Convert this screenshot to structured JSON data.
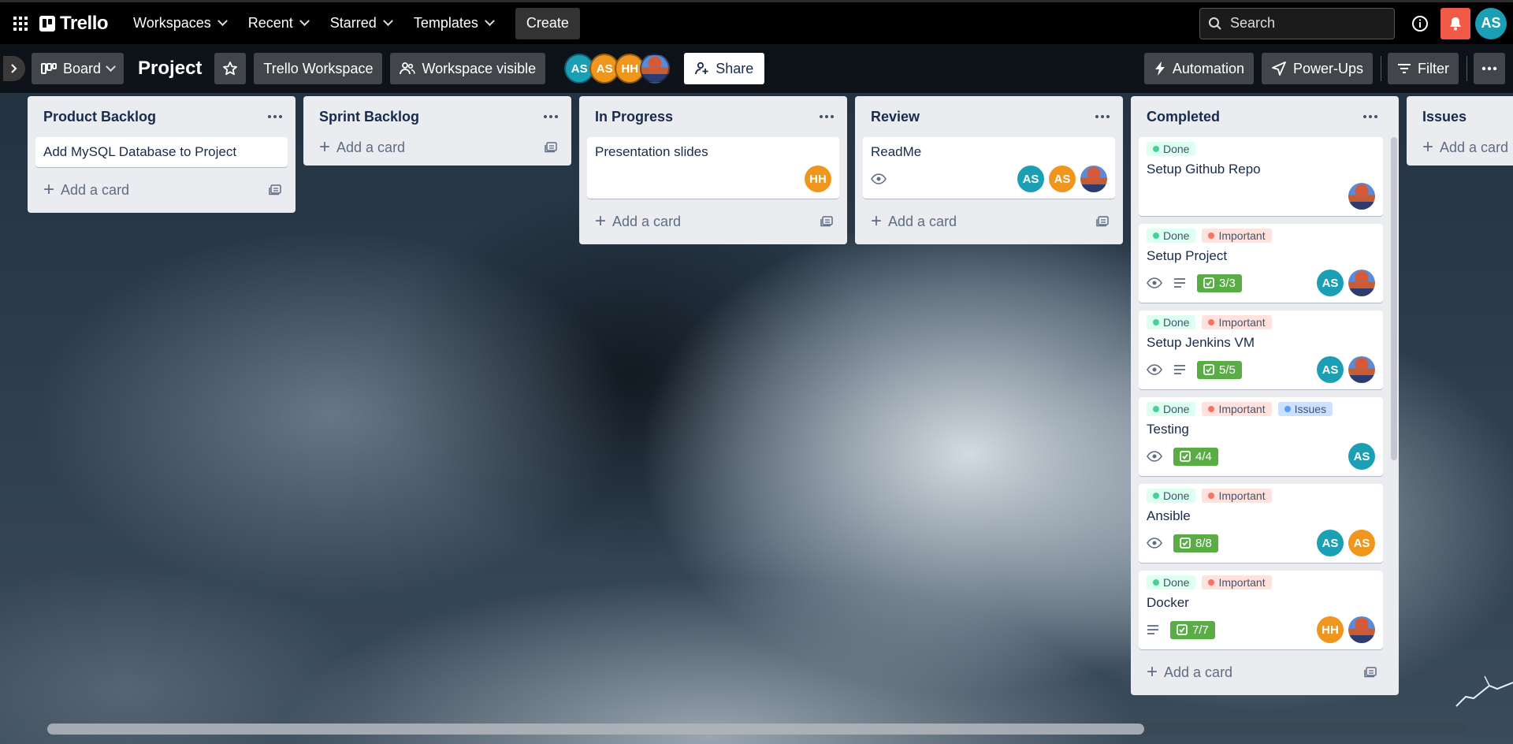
{
  "header": {
    "logo": "Trello",
    "nav": [
      "Workspaces",
      "Recent",
      "Starred",
      "Templates"
    ],
    "create_label": "Create",
    "search_placeholder": "Search",
    "user_initials": "AS"
  },
  "board": {
    "view_label": "Board",
    "title": "Project",
    "workspace_label": "Trello Workspace",
    "visibility_label": "Workspace visible",
    "members": [
      "AS",
      "AS",
      "HH"
    ],
    "share_label": "Share",
    "automation_label": "Automation",
    "powerups_label": "Power-Ups",
    "filter_label": "Filter"
  },
  "add_card_label": "Add a card",
  "lists": [
    {
      "title": "Product Backlog",
      "cards": [
        {
          "title": "Add MySQL Database to Project"
        }
      ]
    },
    {
      "title": "Sprint Backlog",
      "cards": []
    },
    {
      "title": "In Progress",
      "cards": [
        {
          "title": "Presentation slides",
          "members": [
            "HH"
          ]
        }
      ]
    },
    {
      "title": "Review",
      "cards": [
        {
          "title": "ReadMe",
          "members": [
            "AS",
            "AS",
            "photo"
          ]
        }
      ]
    },
    {
      "title": "Completed",
      "cards": [
        {
          "title": "Setup Github Repo",
          "labels": [
            "Done"
          ]
        },
        {
          "title": "Setup Project",
          "labels": [
            "Done",
            "Important"
          ],
          "checklist": "3/3"
        },
        {
          "title": "Setup Jenkins VM",
          "labels": [
            "Done",
            "Important"
          ],
          "checklist": "5/5"
        },
        {
          "title": "Testing",
          "labels": [
            "Done",
            "Important",
            "Issues"
          ],
          "checklist": "4/4"
        },
        {
          "title": "Ansible",
          "labels": [
            "Done",
            "Important"
          ],
          "checklist": "8/8"
        },
        {
          "title": "Docker",
          "labels": [
            "Done",
            "Important"
          ],
          "checklist": "7/7"
        }
      ]
    },
    {
      "title": "Issues",
      "cards": []
    }
  ],
  "colors": {
    "label_done": "#4bce97",
    "label_important": "#f87462",
    "label_issues": "#579dff",
    "checklist_complete": "#5aac44",
    "notification": "#f05a46"
  }
}
